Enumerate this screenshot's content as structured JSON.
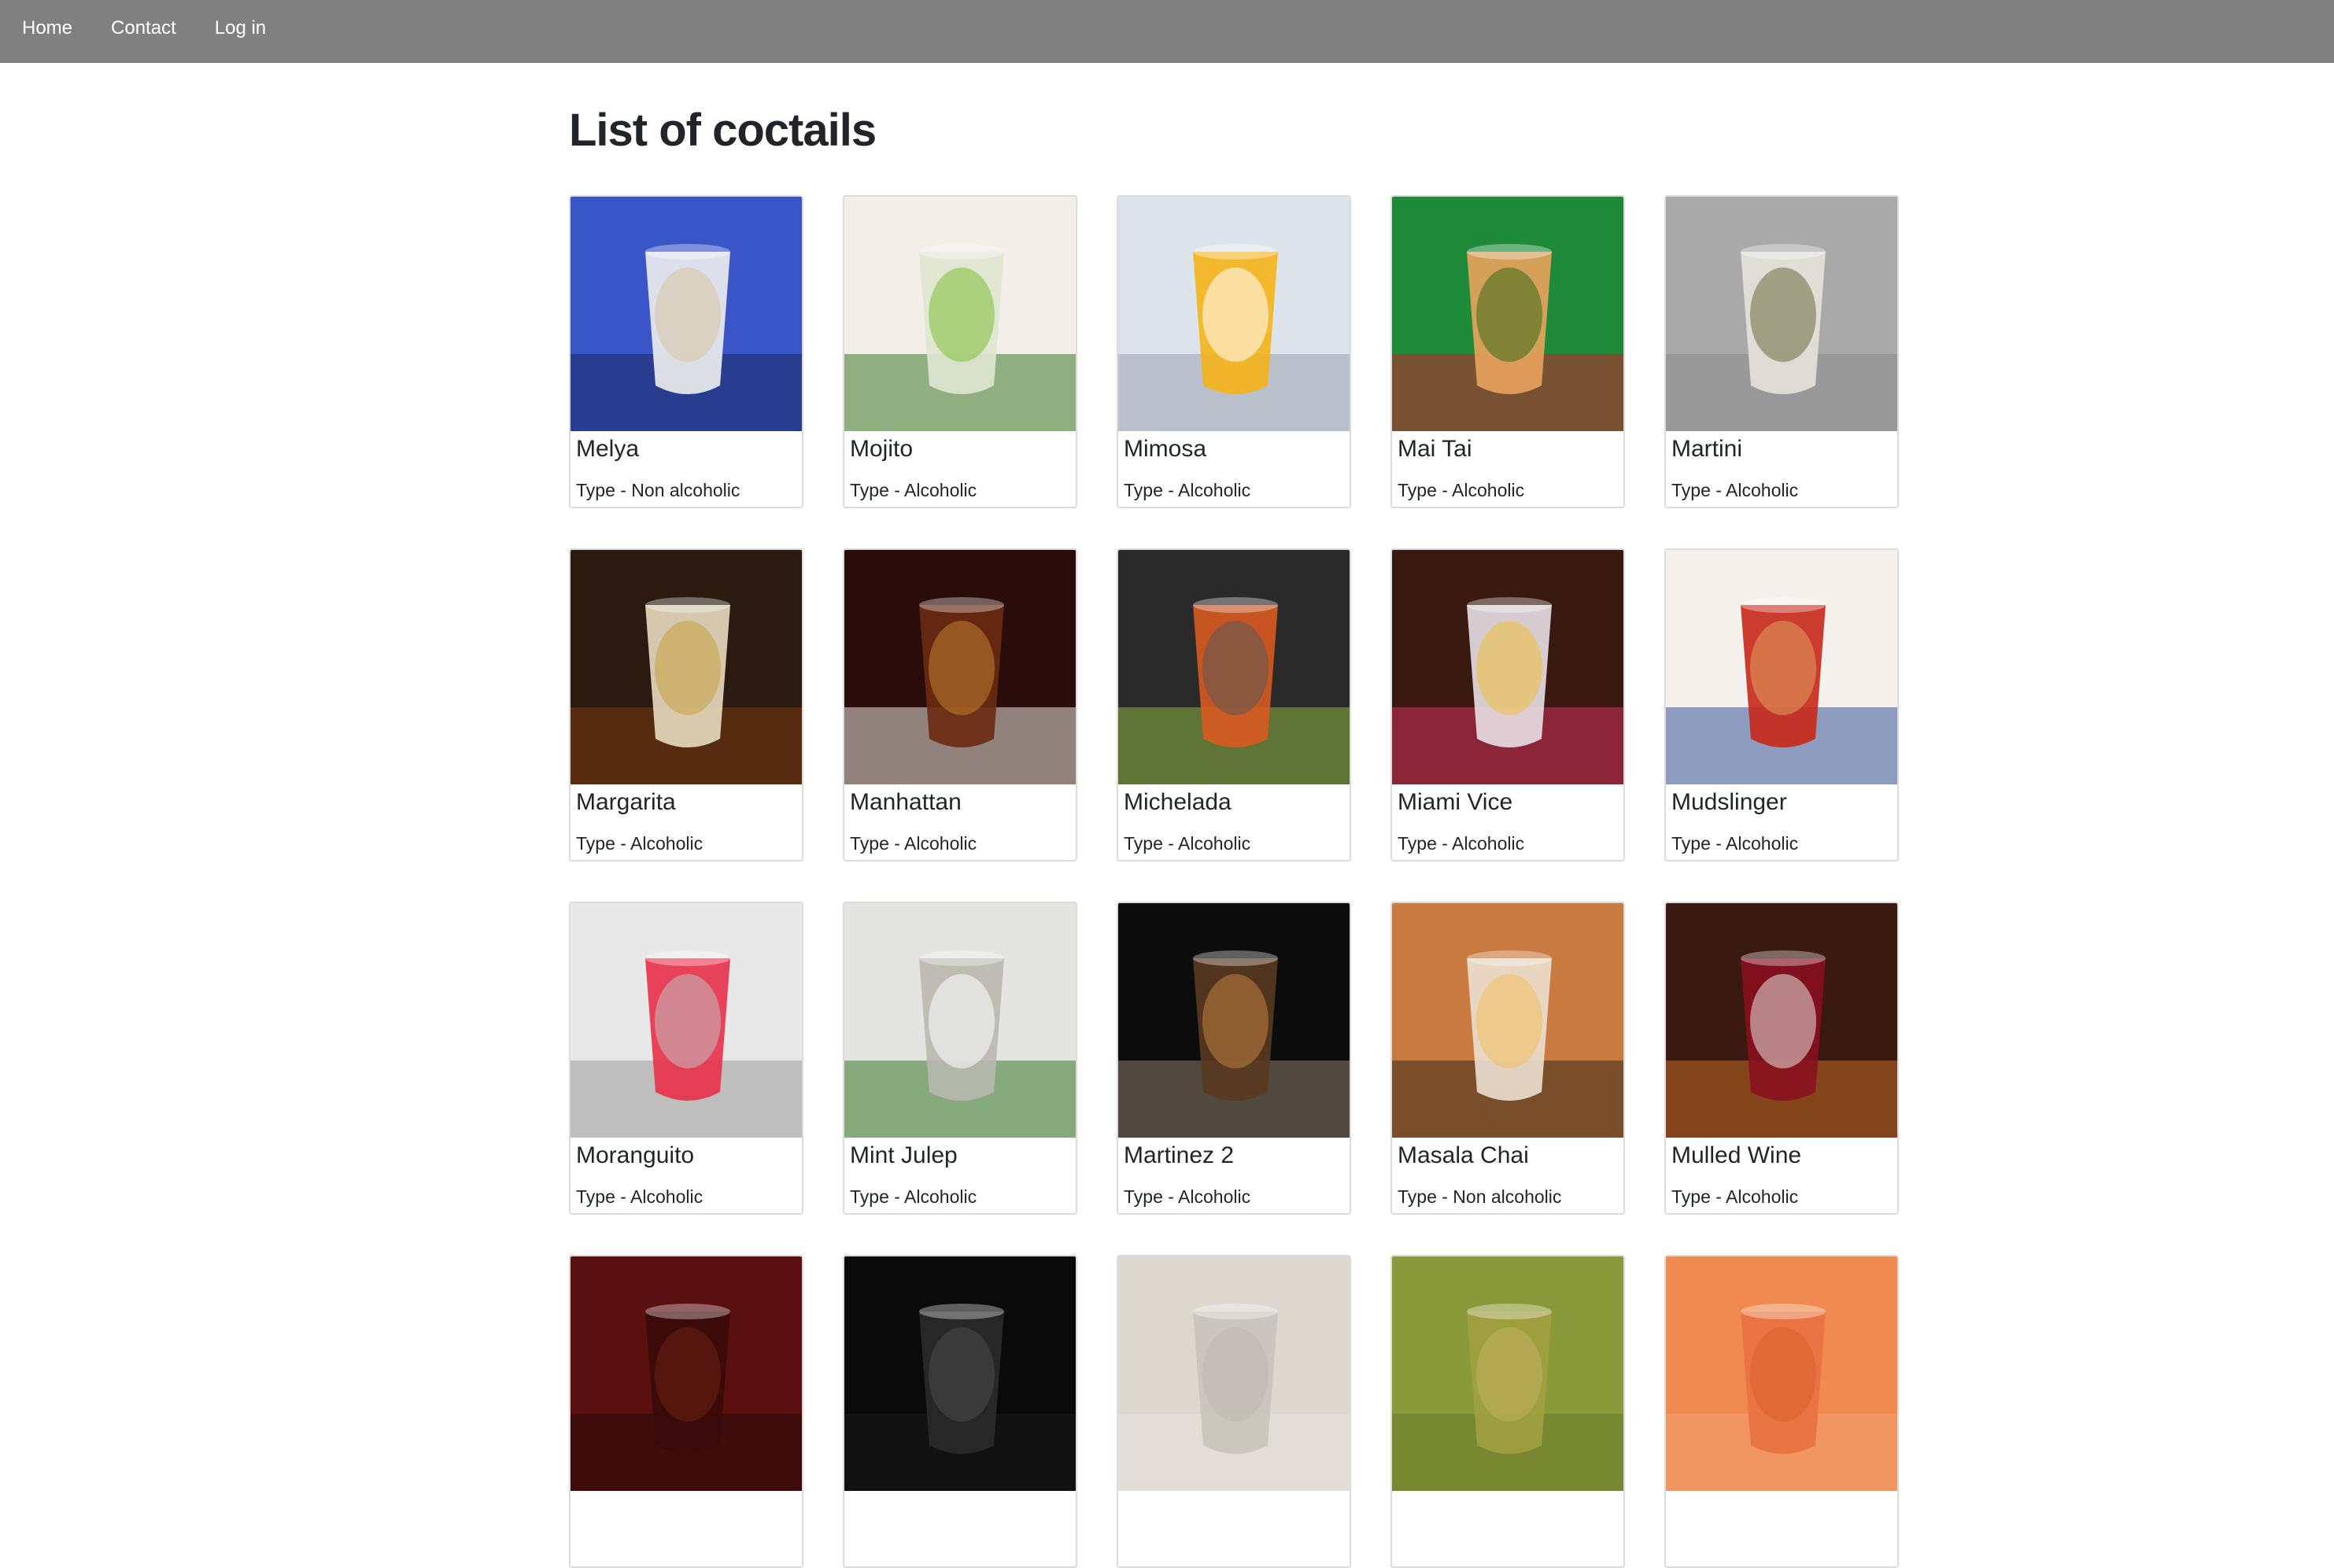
{
  "nav": {
    "items": [
      {
        "label": "Home"
      },
      {
        "label": "Contact"
      },
      {
        "label": "Log in"
      }
    ]
  },
  "page": {
    "title": "List of coctails"
  },
  "cocktails": [
    {
      "name": "Melya",
      "type": "Type - Non alcoholic",
      "palette": [
        "#3a55c8",
        "#f0f0f0",
        "#1a2a60",
        "#d9c4a0"
      ],
      "image": "coffee-cup-photo"
    },
    {
      "name": "Mojito",
      "type": "Type - Alcoholic",
      "palette": [
        "#f2efe8",
        "#dfe6d0",
        "#3f7a2a",
        "#7fbf3a"
      ],
      "image": "mojito-glass-photo"
    },
    {
      "name": "Mimosa",
      "type": "Type - Alcoholic",
      "palette": [
        "#dde3ea",
        "#f6b21a",
        "#9aa4b0",
        "#ffffff"
      ],
      "image": "champagne-flutes-photo"
    },
    {
      "name": "Mai Tai",
      "type": "Type - Alcoholic",
      "palette": [
        "#1f8a3a",
        "#e9a25c",
        "#c0222c",
        "#3b6b1c"
      ],
      "image": "mai-tai-glass-photo"
    },
    {
      "name": "Martini",
      "type": "Type - Alcoholic",
      "palette": [
        "#a9a9a9",
        "#e3e3dc",
        "#8c8c8c",
        "#6b6b40"
      ],
      "image": "martini-glass-photo"
    },
    {
      "name": "Margarita",
      "type": "Type - Alcoholic",
      "palette": [
        "#2a1a10",
        "#e8dcc0",
        "#7a3a10",
        "#c9a040"
      ],
      "image": "margarita-glass-photo"
    },
    {
      "name": "Manhattan",
      "type": "Type - Alcoholic",
      "palette": [
        "#2a0c0a",
        "#6a2a10",
        "#e8e4dc",
        "#c08030"
      ],
      "image": "manhattan-glass-photo"
    },
    {
      "name": "Michelada",
      "type": "Type - Alcoholic",
      "palette": [
        "#2a2a2a",
        "#d85a20",
        "#8ab040",
        "#5a5a5a"
      ],
      "image": "michelada-glass-photo"
    },
    {
      "name": "Miami Vice",
      "type": "Type - Alcoholic",
      "palette": [
        "#3a1a10",
        "#e8e0e4",
        "#d0305a",
        "#f0c040"
      ],
      "image": "miami-vice-glass-photo"
    },
    {
      "name": "Mudslinger",
      "type": "Type - Alcoholic",
      "palette": [
        "#f4f0ec",
        "#c8281a",
        "#3a5a9a",
        "#e0a060"
      ],
      "image": "mason-jars-photo"
    },
    {
      "name": "Moranguito",
      "type": "Type - Alcoholic",
      "palette": [
        "#e8e8e8",
        "#e8304a",
        "#9a9a9a",
        "#c0c0c0"
      ],
      "image": "moranguito-glass-photo"
    },
    {
      "name": "Mint Julep",
      "type": "Type - Alcoholic",
      "palette": [
        "#e4e4e0",
        "#b8b8b0",
        "#3a7a2a",
        "#ffffff"
      ],
      "image": "julep-cups-photo"
    },
    {
      "name": "Martinez 2",
      "type": "Type - Alcoholic",
      "palette": [
        "#0c0c0c",
        "#5a3a20",
        "#8a7a6a",
        "#c08040"
      ],
      "image": "martinez-glass-photo"
    },
    {
      "name": "Masala Chai",
      "type": "Type - Non alcoholic",
      "palette": [
        "#c87a40",
        "#ece0d0",
        "#3a2a1a",
        "#f0c060"
      ],
      "image": "chai-mug-photo"
    },
    {
      "name": "Mulled Wine",
      "type": "Type - Alcoholic",
      "palette": [
        "#3a1a10",
        "#8a1020",
        "#c06a20",
        "#e8e0d8"
      ],
      "image": "mulled-wine-photo"
    },
    {
      "name": "",
      "type": "",
      "palette": [
        "#5a1010",
        "#3a0a0a",
        "#2a0a0a",
        "#6a2010"
      ],
      "image": "partial-photo"
    },
    {
      "name": "",
      "type": "",
      "palette": [
        "#0a0a0a",
        "#2a2a2a",
        "#1a1a1a",
        "#4a4a4a"
      ],
      "image": "partial-photo"
    },
    {
      "name": "",
      "type": "",
      "palette": [
        "#dcd8d0",
        "#c8c4bc",
        "#e8e4dc",
        "#bcb8b0"
      ],
      "image": "partial-photo"
    },
    {
      "name": "",
      "type": "",
      "palette": [
        "#8a9a3a",
        "#a0a040",
        "#6a7a2a",
        "#c0b060"
      ],
      "image": "partial-photo"
    },
    {
      "name": "",
      "type": "",
      "palette": [
        "#f08a50",
        "#e87040",
        "#f4a070",
        "#d86030"
      ],
      "image": "partial-photo"
    }
  ]
}
